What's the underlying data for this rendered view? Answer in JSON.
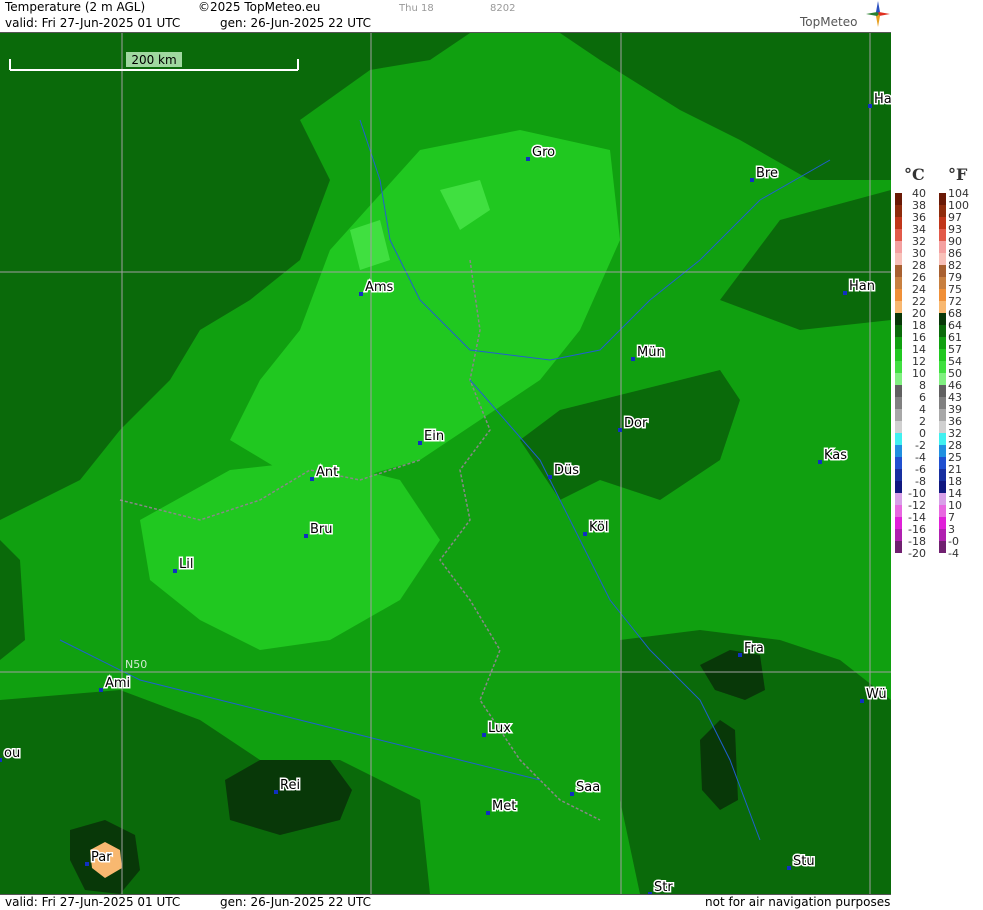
{
  "header": {
    "title": "Temperature (2 m AGL)",
    "copyright": "©2025 TopMeteo.eu",
    "day": "Thu 18",
    "code": "8202",
    "valid": "valid:  Fri  27-Jun-2025  01 UTC",
    "gen": "gen: 26-Jun-2025 22 UTC",
    "logo": "TopMeteo"
  },
  "footer": {
    "valid": "valid:  Fri  27-Jun-2025  01 UTC",
    "gen": "gen: 26-Jun-2025 22 UTC",
    "note": "not for air navigation purposes"
  },
  "map": {
    "scale_label": "200 km",
    "grid_label": "N50",
    "cities": [
      {
        "label": "Ha"
      },
      {
        "label": "Gro"
      },
      {
        "label": "Bre"
      },
      {
        "label": "Ams"
      },
      {
        "label": "Han"
      },
      {
        "label": "Mün"
      },
      {
        "label": "Dor"
      },
      {
        "label": "Ein"
      },
      {
        "label": "Ant"
      },
      {
        "label": "Düs"
      },
      {
        "label": "Kas"
      },
      {
        "label": "Bru"
      },
      {
        "label": "Köl"
      },
      {
        "label": "Lil"
      },
      {
        "label": "Fra"
      },
      {
        "label": "Ami"
      },
      {
        "label": "Wü"
      },
      {
        "label": "Lux"
      },
      {
        "label": "ou"
      },
      {
        "label": "Rei"
      },
      {
        "label": "Saa"
      },
      {
        "label": "Met"
      },
      {
        "label": "Par"
      },
      {
        "label": "Stu"
      },
      {
        "label": "Str"
      }
    ]
  },
  "legend": {
    "unit_c": "°C",
    "unit_f": "°F",
    "celsius": [
      "40",
      "38",
      "36",
      "34",
      "32",
      "30",
      "28",
      "26",
      "24",
      "22",
      "20",
      "18",
      "16",
      "14",
      "12",
      "10",
      "8",
      "6",
      "4",
      "2",
      "0",
      "-2",
      "-4",
      "-6",
      "-8",
      "-10",
      "-12",
      "-14",
      "-16",
      "-18",
      "-20"
    ],
    "fahrenheit": [
      "104",
      "100",
      "97",
      "93",
      "90",
      "86",
      "82",
      "79",
      "75",
      "72",
      "68",
      "64",
      "61",
      "57",
      "54",
      "50",
      "46",
      "43",
      "39",
      "36",
      "32",
      "28",
      "25",
      "21",
      "18",
      "14",
      "10",
      "7",
      "3",
      "-0",
      "-4"
    ],
    "colors": [
      "#6a1a06",
      "#8e2c0c",
      "#c0361a",
      "#e25a4a",
      "#f4a0a0",
      "#f8c0b8",
      "#a86030",
      "#c88040",
      "#f09038",
      "#f8b870",
      "#083808",
      "#0a6a0a",
      "#10a010",
      "#20c820",
      "#40e040",
      "#80f080",
      "#606060",
      "#808080",
      "#a8a8a8",
      "#d0d0d0",
      "#40f0f0",
      "#2090e0",
      "#2050d0",
      "#1830a0",
      "#101880",
      "#d8a0e8",
      "#e868e0",
      "#e020d8",
      "#b020b0",
      "#702070"
    ]
  }
}
